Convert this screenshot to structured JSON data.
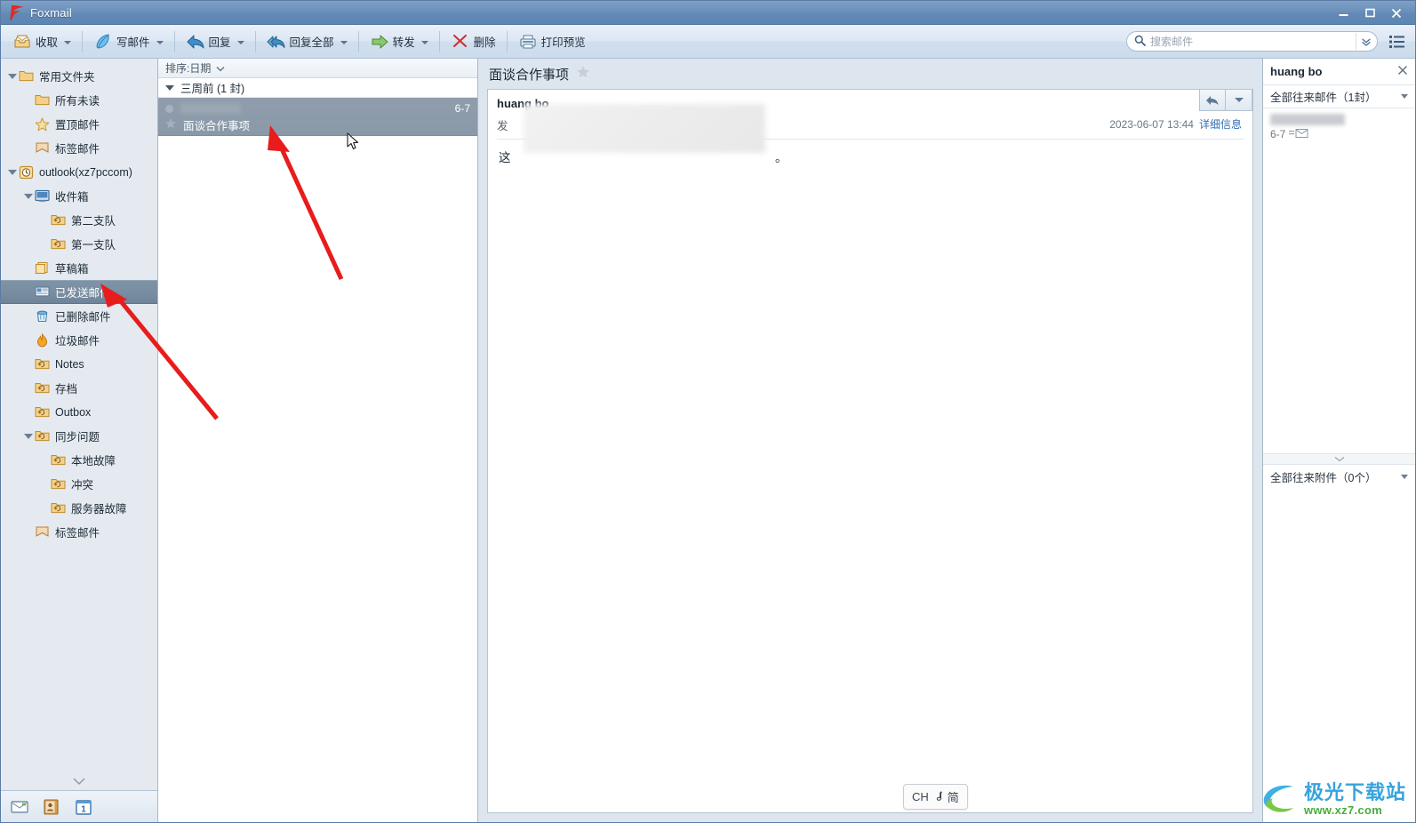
{
  "window": {
    "title": "Foxmail",
    "logo_icon": "foxmail-logo-icon",
    "minimize_label": "—",
    "maximize_label": "▢",
    "close_label": "✕"
  },
  "toolbar": {
    "buttons": [
      {
        "label": "收取",
        "icon": "inbox-receive-icon",
        "has_caret": true
      },
      {
        "label": "写邮件",
        "icon": "compose-feather-icon",
        "has_caret": true
      },
      {
        "label": "回复",
        "icon": "reply-arrow-icon",
        "has_caret": true
      },
      {
        "label": "回复全部",
        "icon": "reply-all-arrow-icon",
        "has_caret": true
      },
      {
        "label": "转发",
        "icon": "forward-arrow-icon",
        "has_caret": true
      },
      {
        "label": "删除",
        "icon": "delete-scissors-icon",
        "has_caret": false
      },
      {
        "label": "打印预览",
        "icon": "printer-icon",
        "has_caret": false
      }
    ],
    "search": {
      "placeholder": "搜索邮件",
      "value": "",
      "icon": "search-icon",
      "dropdown_icon": "chevron-double-down-icon"
    },
    "list_toggle_icon": "list-view-icon"
  },
  "sidebar": {
    "items": [
      {
        "label": "常用文件夹",
        "icon": "folder-icon",
        "indent": 0,
        "twisty": true,
        "selected": false
      },
      {
        "label": "所有未读",
        "icon": "folder-icon",
        "indent": 1,
        "twisty": false,
        "selected": false
      },
      {
        "label": "置顶邮件",
        "icon": "star-icon",
        "indent": 1,
        "twisty": false,
        "selected": false
      },
      {
        "label": "标签邮件",
        "icon": "tag-icon",
        "indent": 1,
        "twisty": false,
        "selected": false
      },
      {
        "label": "outlook(xz7pccom)",
        "icon": "account-clock-icon",
        "indent": 0,
        "twisty": true,
        "selected": false
      },
      {
        "label": "收件箱",
        "icon": "inbox-icon",
        "indent": 1,
        "twisty": true,
        "selected": false
      },
      {
        "label": "第二支队",
        "icon": "sync-folder-icon",
        "indent": 2,
        "twisty": false,
        "selected": false
      },
      {
        "label": "第一支队",
        "icon": "sync-folder-icon",
        "indent": 2,
        "twisty": false,
        "selected": false
      },
      {
        "label": "草稿箱",
        "icon": "draft-icon",
        "indent": 1,
        "twisty": false,
        "selected": false
      },
      {
        "label": "已发送邮件",
        "icon": "sent-icon",
        "indent": 1,
        "twisty": false,
        "selected": true
      },
      {
        "label": "已删除邮件",
        "icon": "trash-icon",
        "indent": 1,
        "twisty": false,
        "selected": false
      },
      {
        "label": "垃圾邮件",
        "icon": "junk-flame-icon",
        "indent": 1,
        "twisty": false,
        "selected": false
      },
      {
        "label": "Notes",
        "icon": "sync-folder-icon",
        "indent": 1,
        "twisty": false,
        "selected": false
      },
      {
        "label": "存档",
        "icon": "sync-folder-icon",
        "indent": 1,
        "twisty": false,
        "selected": false
      },
      {
        "label": "Outbox",
        "icon": "sync-folder-icon",
        "indent": 1,
        "twisty": false,
        "selected": false
      },
      {
        "label": "同步问题",
        "icon": "sync-folder-icon",
        "indent": 1,
        "twisty": true,
        "selected": false
      },
      {
        "label": "本地故障",
        "icon": "sync-folder-icon",
        "indent": 2,
        "twisty": false,
        "selected": false
      },
      {
        "label": "冲突",
        "icon": "sync-folder-icon",
        "indent": 2,
        "twisty": false,
        "selected": false
      },
      {
        "label": "服务器故障",
        "icon": "sync-folder-icon",
        "indent": 2,
        "twisty": false,
        "selected": false
      },
      {
        "label": "标签邮件",
        "icon": "tag-icon",
        "indent": 1,
        "twisty": false,
        "selected": false
      }
    ],
    "bottom_icons": [
      {
        "name": "mail-module-icon"
      },
      {
        "name": "contacts-module-icon"
      },
      {
        "name": "calendar-module-icon"
      }
    ]
  },
  "maillist": {
    "sort_label": "排序:日期",
    "group": {
      "label": "三周前 (1 封)"
    },
    "items": [
      {
        "subject": "面谈合作事项",
        "date": "6-7",
        "sender_masked": true,
        "selected": true
      }
    ]
  },
  "reading": {
    "subject": "面谈合作事项",
    "star_icon": "star-icon",
    "from": "huang bo",
    "to_prefix": "发",
    "timestamp": "2023-06-07 13:44",
    "detail_link": "详细信息",
    "body_prefix": "这",
    "body_suffix": "。",
    "actions": [
      {
        "name": "reply-button",
        "icon": "reply-arrow-icon"
      },
      {
        "name": "more-actions-button",
        "icon": "chevron-down-icon"
      }
    ],
    "ime": {
      "lang": "CH",
      "mode_icon": "moon-icon",
      "mode": "简"
    }
  },
  "rightpane": {
    "title": "huang bo",
    "close_icon": "close-icon",
    "mail_section": "全部往来邮件（1封）",
    "items": [
      {
        "date": "6-7",
        "icon": "mail-small-icon"
      }
    ],
    "attach_section": "全部往来附件（0个）"
  },
  "watermark": {
    "cn": "极光下载站",
    "url": "www.xz7.com"
  }
}
